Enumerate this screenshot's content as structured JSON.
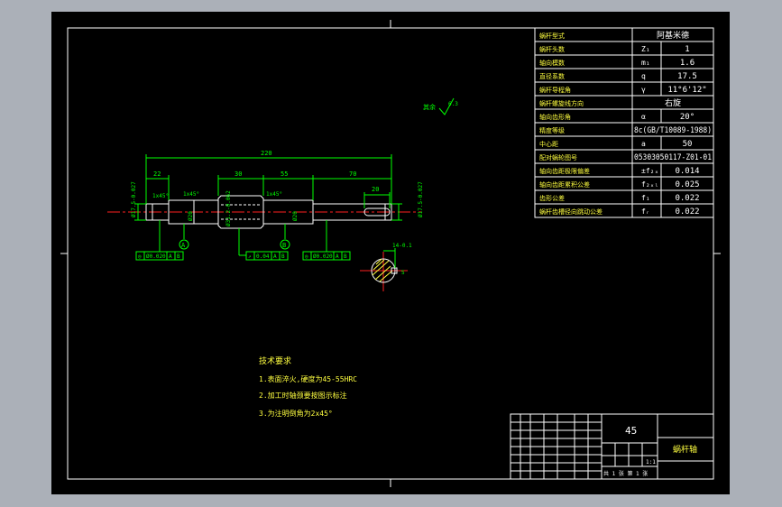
{
  "params_table": [
    {
      "label": "蜗杆型式",
      "symbol": "",
      "value": "阿基米德"
    },
    {
      "label": "蜗杆头数",
      "symbol": "Z₁",
      "value": "1"
    },
    {
      "label": "轴向模数",
      "symbol": "m₁",
      "value": "1.6"
    },
    {
      "label": "直径系数",
      "symbol": "q",
      "value": "17.5"
    },
    {
      "label": "蜗杆导程角",
      "symbol": "γ",
      "value": "11°6'12\""
    },
    {
      "label": "蜗杆螺旋线方向",
      "symbol": "",
      "value": "右旋"
    },
    {
      "label": "轴向齿形角",
      "symbol": "α",
      "value": "20°"
    },
    {
      "label": "精度等级",
      "symbol": "",
      "value": "8c(GB/T10089-1988)"
    },
    {
      "label": "中心距",
      "symbol": "a",
      "value": "50"
    },
    {
      "label": "配对蜗轮图号",
      "symbol": "",
      "value": "05303050117-Z01-01"
    },
    {
      "label": "轴向齿距极限偏差",
      "symbol": "±f₂ₓ",
      "value": "0.014"
    },
    {
      "label": "轴向齿距累积公差",
      "symbol": "f₂ₓₗ",
      "value": "0.025"
    },
    {
      "label": "齿形公差",
      "symbol": "f₁",
      "value": "0.022"
    },
    {
      "label": "蜗杆齿槽径向跳动公差",
      "symbol": "fᵣ",
      "value": "0.022"
    }
  ],
  "dimensions": {
    "overall_length": "220",
    "seg_22": "22",
    "seg_30": "30",
    "seg_55": "55",
    "seg_70": "70",
    "seg_20": "20",
    "dia_left": "Ø17.5-0.027",
    "dia_right": "Ø17.5-0.027",
    "dia_20a": "Ø20",
    "dia_20b": "Ø20",
    "dia_worm": "Ø31.2-0.062",
    "ch_left": "1x45°",
    "ch_mid": "1x45°",
    "ch_right": "1x45°",
    "key_depth": "14-0.1",
    "key_width": "5",
    "roughness": "6.3",
    "roughness_note": "其余"
  },
  "datums": {
    "a": "A",
    "b": "B"
  },
  "gtol": {
    "left": [
      "◎",
      "Ø0.020",
      "A",
      "B"
    ],
    "mid": [
      "↗",
      "0.04",
      "A",
      "B"
    ],
    "right": [
      "◎",
      "Ø0.020",
      "A",
      "B"
    ]
  },
  "requirements": {
    "title": "技术要求",
    "items": [
      "1.表面淬火,硬度为45-55HRC",
      "2.加工时轴颈要按图示标注",
      "3.为注明倒角为2x45°"
    ]
  },
  "title_block": {
    "material": "45",
    "part_name": "蜗杆轴",
    "scale": "1:1",
    "sheets": "共 1 张 第 1 张"
  },
  "colors": {
    "background": "#000000",
    "frame": "#ffffff",
    "geometry": "#00ff00",
    "centerline": "#ff2020",
    "hatching": "#ffff40",
    "outer": "#abb0b8"
  }
}
